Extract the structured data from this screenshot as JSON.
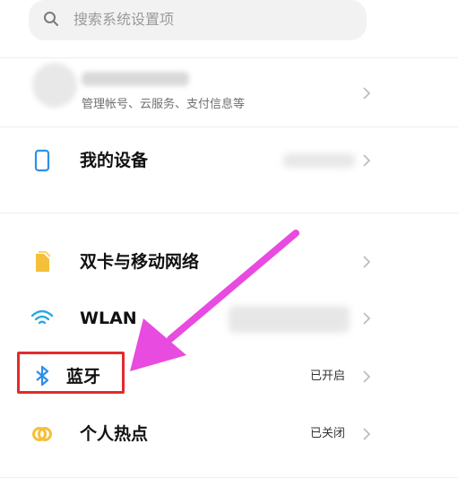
{
  "search": {
    "placeholder": "搜索系统设置项"
  },
  "account": {
    "subtitle": "管理帐号、云服务、支付信息等"
  },
  "items": [
    {
      "label": "我的设备",
      "value": ""
    },
    {
      "label": "双卡与移动网络",
      "value": ""
    },
    {
      "label": "WLAN",
      "value": ""
    },
    {
      "label": "蓝牙",
      "value": "已开启"
    },
    {
      "label": "个人热点",
      "value": "已关闭"
    }
  ],
  "annotation": {
    "highlight_color": "#e32a2a",
    "arrow_color": "#e84be0"
  },
  "icons": [
    "search-icon",
    "phone-device-icon",
    "sim-card-icon",
    "wifi-icon",
    "bluetooth-icon",
    "hotspot-icon",
    "chevron-right-icon"
  ]
}
